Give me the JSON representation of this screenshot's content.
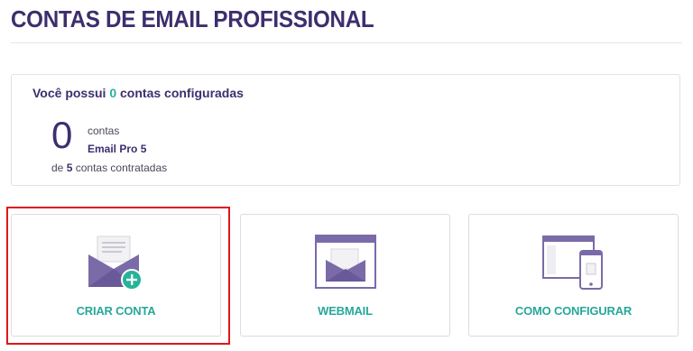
{
  "page": {
    "title": "CONTAS DE EMAIL PROFISSIONAL"
  },
  "summary": {
    "heading_prefix": "Você possui",
    "configured_count": "0",
    "heading_suffix": "contas configuradas",
    "big_count": "0",
    "unit": "contas",
    "plan": "Email Pro 5",
    "contracted_prefix": "de",
    "contracted_count": "5",
    "contracted_suffix": "contas contratadas"
  },
  "actions": [
    {
      "label": "CRIAR CONTA",
      "icon": "envelope-plus-icon"
    },
    {
      "label": "WEBMAIL",
      "icon": "webmail-window-icon"
    },
    {
      "label": "COMO CONFIGURAR",
      "icon": "devices-icon"
    }
  ],
  "colors": {
    "primary": "#3d2e6e",
    "accent": "#27b1a4",
    "icon": "#7b6aa8",
    "highlight": "#e0161b"
  }
}
